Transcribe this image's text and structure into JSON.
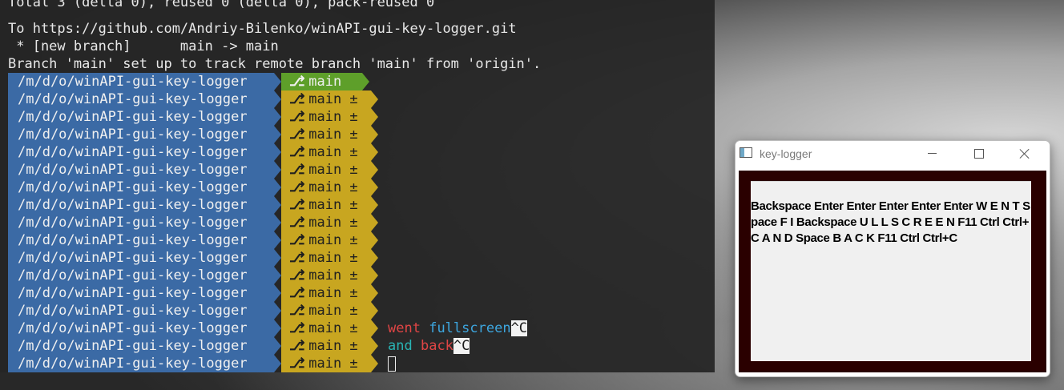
{
  "terminal": {
    "output_lines": [
      "Total 3 (delta 0), reused 0 (delta 0), pack-reused 0",
      "To https://github.com/Andriy-Bilenko/winAPI-gui-key-logger.git",
      " * [new branch]      main -> main",
      "Branch 'main' set up to track remote branch 'main' from 'origin'."
    ],
    "prompt_path": "/m/d/o/winAPI-gui-key-logger",
    "branch_name": "main",
    "dirty_marker": "±",
    "branch_glyph": "⎇",
    "colors": {
      "path_segment": "#3b6aa5",
      "branch_clean": "#5e9f2a",
      "branch_dirty": "#c8a620"
    },
    "typed": {
      "line1_word1": "went",
      "line1_word2": "fullscreen",
      "line2_word1": "and",
      "line2_word2": "back",
      "interrupt": "^C"
    }
  },
  "keylogger_window": {
    "title": "key-logger",
    "icon": "app-window-icon",
    "controls": {
      "minimize": "minimize-icon",
      "maximize": "maximize-icon",
      "close": "close-icon"
    },
    "logged_keys": "Backspace Enter Enter Enter Enter Enter W E N T Space F I Backspace U L L S C R E E N F11 Ctrl Ctrl+C A N D Space B A C K F11 Ctrl Ctrl+C",
    "colors": {
      "client_background": "#2a0000",
      "text_area": "#f0f0f0"
    }
  }
}
